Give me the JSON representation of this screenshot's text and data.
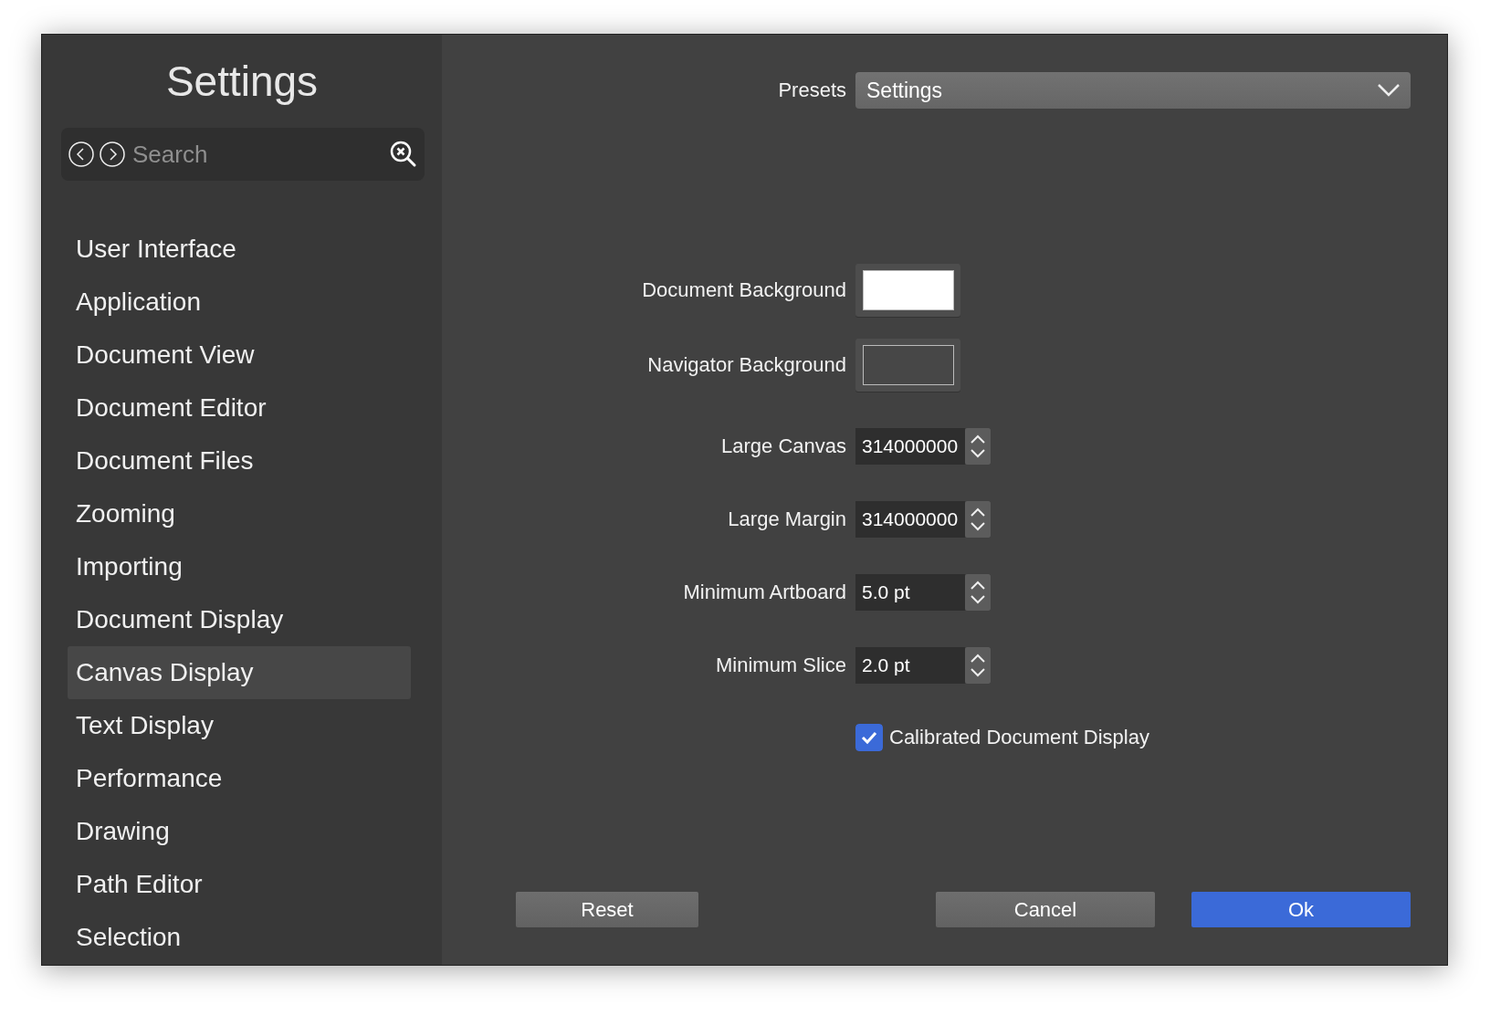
{
  "window": {
    "title": "Settings"
  },
  "search": {
    "placeholder": "Search"
  },
  "sidebar": {
    "items": [
      {
        "label": "User Interface",
        "selected": false
      },
      {
        "label": "Application",
        "selected": false
      },
      {
        "label": "Document View",
        "selected": false
      },
      {
        "label": "Document Editor",
        "selected": false
      },
      {
        "label": "Document Files",
        "selected": false
      },
      {
        "label": "Zooming",
        "selected": false
      },
      {
        "label": "Importing",
        "selected": false
      },
      {
        "label": "Document Display",
        "selected": false
      },
      {
        "label": "Canvas Display",
        "selected": true
      },
      {
        "label": "Text Display",
        "selected": false
      },
      {
        "label": "Performance",
        "selected": false
      },
      {
        "label": "Drawing",
        "selected": false
      },
      {
        "label": "Path Editor",
        "selected": false
      },
      {
        "label": "Selection",
        "selected": false
      }
    ]
  },
  "presets": {
    "label": "Presets",
    "value": "Settings"
  },
  "fields": [
    {
      "kind": "color",
      "label": "Document Background",
      "color": "#ffffff"
    },
    {
      "kind": "color",
      "label": "Navigator Background",
      "color": "#474747"
    },
    {
      "kind": "number",
      "label": "Large Canvas",
      "value": "314000000"
    },
    {
      "kind": "number",
      "label": "Large Margin",
      "value": "314000000"
    },
    {
      "kind": "number",
      "label": "Minimum Artboard",
      "value": "5.0 pt"
    },
    {
      "kind": "number",
      "label": "Minimum Slice",
      "value": "2.0 pt"
    }
  ],
  "checkbox": {
    "label": "Calibrated Document Display",
    "checked": true
  },
  "buttons": [
    {
      "label": "Reset",
      "kind": "secondary"
    },
    {
      "label": "Cancel",
      "kind": "secondary"
    },
    {
      "label": "Ok",
      "kind": "primary"
    }
  ]
}
